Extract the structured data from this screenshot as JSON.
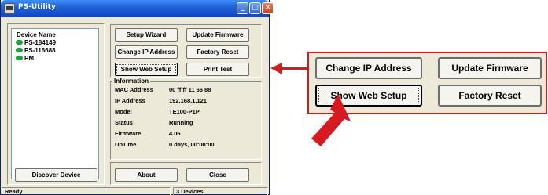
{
  "window": {
    "title": "PS-Utility",
    "controls": {
      "minimize": "_",
      "maximize": "□",
      "close": "✕"
    }
  },
  "devices": {
    "header": "Device Name",
    "items": [
      {
        "label": "PS-184149",
        "status_color": "#1aa33a"
      },
      {
        "label": "PS-116688",
        "status_color": "#1aa33a"
      },
      {
        "label": "PM",
        "status_color": "#1aa33a"
      }
    ],
    "discover_label": "Discover Device"
  },
  "actions": {
    "setup_wizard": "Setup Wizard",
    "update_firmware": "Update Firmware",
    "change_ip": "Change IP Address",
    "factory_reset": "Factory Reset",
    "show_web_setup": "Show Web Setup",
    "print_test": "Print Test",
    "about": "About",
    "close": "Close"
  },
  "information": {
    "title": "Information",
    "rows": [
      {
        "label": "MAC Address",
        "value": "00 ff ff 11 66 88"
      },
      {
        "label": "IP Address",
        "value": "192.168.1.121"
      },
      {
        "label": "Model",
        "value": "TE100-P1P"
      },
      {
        "label": "Status",
        "value": "Running"
      },
      {
        "label": "Firmware",
        "value": "4.06"
      },
      {
        "label": "UpTime",
        "value": "0 days, 00:00:00"
      }
    ]
  },
  "statusbar": {
    "left": "Ready",
    "right": "3 Devices"
  },
  "callout": {
    "change_ip": "Change IP Address",
    "update_firmware": "Update Firmware",
    "show_web_setup": "Show Web Setup",
    "factory_reset": "Factory Reset"
  },
  "colors": {
    "accent": "#d71920",
    "window_bg": "#ece9d8",
    "titlebar": "#0b46c4"
  }
}
